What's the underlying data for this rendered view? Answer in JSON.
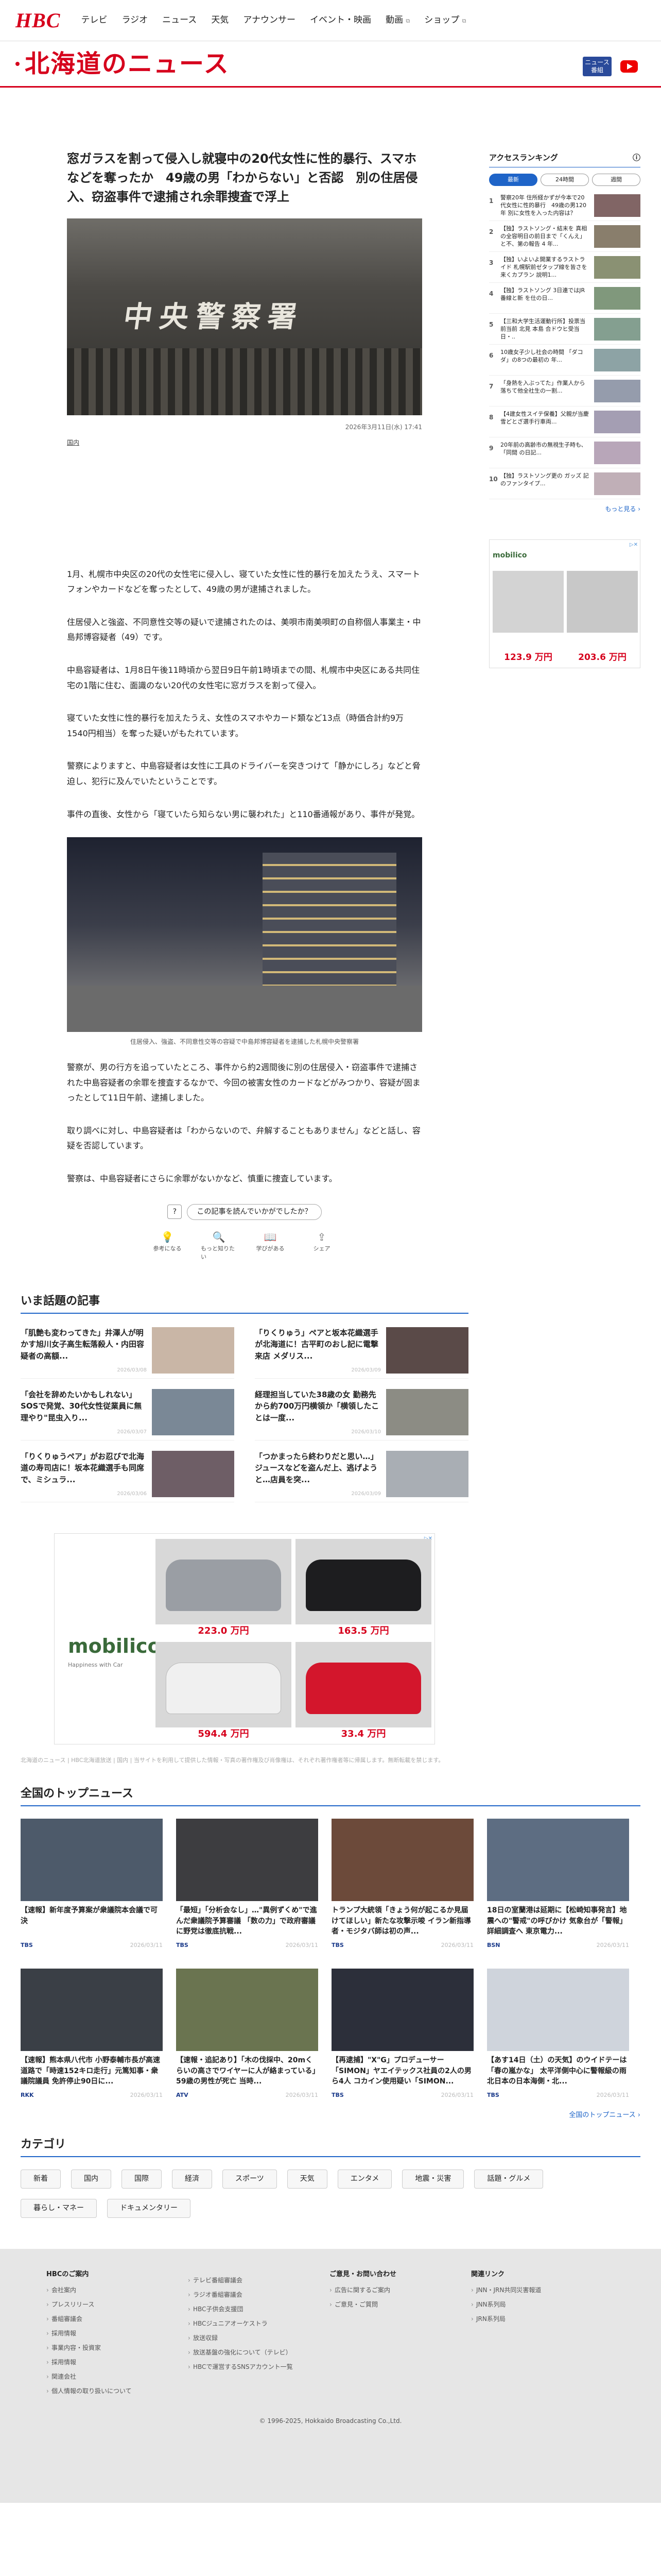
{
  "header": {
    "logo": "HBC",
    "nav": [
      "テレビ",
      "ラジオ",
      "ニュース",
      "天気",
      "アナウンサー",
      "イベント・映画",
      "動画",
      "ショップ"
    ],
    "brand": "北海道のニュース",
    "news_icon": "ニュース\n番組",
    "colors": {
      "accent": "#d6001c",
      "link": "#1e64c8"
    }
  },
  "article": {
    "title": "窓ガラスを割って侵入し就寝中の20代女性に性的暴行、スマホなどを奪ったか　49歳の男「わからない」と否認　別の住居侵入、窃盗事件で逮捕され余罪捜査で浮上",
    "photo_sign": "中央警察署",
    "date": "2026年3月11日(水) 17:41",
    "category": "国内",
    "paragraphs": [
      "1月、札幌市中央区の20代の女性宅に侵入し、寝ていた女性に性的暴行を加えたうえ、スマートフォンやカードなどを奪ったとして、49歳の男が逮捕されました。",
      "住居侵入と強盗、不同意性交等の疑いで逮捕されたのは、美唄市南美唄町の自称個人事業主・中島邦博容疑者（49）です。",
      "中島容疑者は、1月8日午後11時頃から翌日9日午前1時頃までの間、札幌市中央区にある共同住宅の1階に住む、面識のない20代の女性宅に窓ガラスを割って侵入。",
      "寝ていた女性に性的暴行を加えたうえ、女性のスマホやカード類など13点（時価合計約9万1540円相当）を奪った疑いがもたれています。",
      "警察によりますと、中島容疑者は女性に工具のドライバーを突きつけて「静かにしろ」などと脅迫し、犯行に及んでいたということです。",
      "事件の直後、女性から「寝ていたら知らない男に襲われた」と110番通報があり、事件が発覚。"
    ],
    "caption": "住居侵入、強盗、不同意性交等の容疑で中島邦博容疑者を逮捕した札幌中央警察署",
    "paragraphs2": [
      "警察が、男の行方を追っていたところ、事件から約2週間後に別の住居侵入・窃盗事件で逮捕された中島容疑者の余罪を捜査するなかで、今回の被害女性のカードなどがみつかり、容疑が固まったとして11日午前、逮捕しました。",
      "取り調べに対し、中島容疑者は「わからないので、弁解することもありません」などと話し、容疑を否認しています。",
      "警察は、中島容疑者にさらに余罪がないかなど、慎重に捜査しています。"
    ],
    "ask": "この記事を読んでいかがでしたか？",
    "reactions": [
      "参考になる",
      "もっと知りたい",
      "学びがある",
      "シェア"
    ]
  },
  "topics": {
    "title": "いま話題の記事",
    "items": [
      {
        "t": "「肌艶も変わってきた」井澤人が明かす旭川女子高生転落殺人・内田容疑者の高額...",
        "d": "2026/03/08"
      },
      {
        "t": "「りくりゅう」ペアと坂本花織選手が北海道に！古平町のおし記に電撃来店 メダリス...",
        "d": "2026/03/09"
      },
      {
        "t": "「会社を辞めたいかもしれない」SOSで発覚、30代女性従業員に無理やり\"昆虫入り...",
        "d": "2026/03/07"
      },
      {
        "t": "経理担当していた38歳の女 勤務先から約700万円横領か「横領したことは一度...",
        "d": "2026/03/10"
      },
      {
        "t": "「りくりゅうペア」がお忍びで北海道の寿司店に！坂本花織選手も同席で、ミシュラ...",
        "d": "2026/03/06"
      },
      {
        "t": "「つかまったら終わりだと思い…」ジュースなどを盗んだ上、逃げようと…店員を突...",
        "d": "2026/03/09"
      }
    ]
  },
  "ad_big": {
    "logo": "mobilico",
    "tagline": "Happiness with Car",
    "prices": [
      "223.0 万円",
      "163.5 万円",
      "594.4 万円",
      "33.4 万円"
    ]
  },
  "fineprint": "北海道のニュース | HBC北海道放送 | 国内 | 当サイトを利用して提供した情報・写真の著作権及び肖像権は、それぞれ著作権者等に帰属します。無断転載を禁じます。",
  "national": {
    "title": "全国のトップニュース",
    "items": [
      {
        "t": "【速報】新年度予算案が衆議院本会議で可決",
        "s": "TBS",
        "d": "2026/03/11"
      },
      {
        "t": "「最短」「分析会なし」…\"異例ずくめ\"で進んだ衆議院予算審議 「数の力」で政府審議に野党は徹底抗戦...",
        "s": "TBS",
        "d": "2026/03/11"
      },
      {
        "t": "トランプ大統領「きょう何が起こるか見届けてほしい」新たな攻撃示唆 イラン新指導者・モジタバ師は初の声...",
        "s": "TBS",
        "d": "2026/03/11"
      },
      {
        "t": "18日の室蘭港は延期に【松崎知事発言】地震への\"警戒\"の呼びかけ 気象台が「警報」詳細調査へ 東京電力...",
        "s": "BSN",
        "d": "2026/03/11"
      },
      {
        "t": "【速報】熊本県八代市 小野泰輔市長が高速道路で「時速152キロ走行」元篤知事・衆議院議員 免許停止90日に...",
        "s": "RKK",
        "d": "2026/03/11"
      },
      {
        "t": "【速報・追記あり】「木の伐採中、20mくらいの高さでワイヤーに人が絡まっている」59歳の男性が死亡 当時...",
        "s": "ATV",
        "d": "2026/03/11"
      },
      {
        "t": "【再逮捕】\"X\"G」プロデューサー「SIMON」ヤエイテックス社員の2人の男ら4人 コカイン使用疑い「SIMON...",
        "s": "TBS",
        "d": "2026/03/11"
      },
      {
        "t": "【あす14日（土）の天気】のウイドテーは「春の嵐かな」 太平洋側中心に警報級の雨 北日本の日本海側・北...",
        "s": "TBS",
        "d": "2026/03/11"
      }
    ],
    "more": "全国のトップニュース ›"
  },
  "categories": {
    "title": "カテゴリ",
    "items": [
      "新着",
      "国内",
      "国際",
      "経済",
      "スポーツ",
      "天気",
      "エンタメ",
      "地震・災害",
      "話題・グルメ",
      "暮らし・マネー",
      "ドキュメンタリー"
    ]
  },
  "ranking": {
    "title": "アクセスランキング",
    "tabs": [
      "最新",
      "24時間",
      "週間"
    ],
    "items": [
      {
        "n": "1",
        "t": "警察20年 住所経かずが今本で20代女性に性的暴行　49歳の男120年 別に女性を入った内容は？"
      },
      {
        "n": "2",
        "t": "【独】ラストソング・結末を 真相の全容明日の前日まで「くんえ」と不、第の報告 4 年..."
      },
      {
        "n": "3",
        "t": "【独】いよいよ開業するラストライド 札幌駅前ゼタップ線を皆さを来くカプラン 説明1..."
      },
      {
        "n": "4",
        "t": "【独】ラストソング 3日連ではJR番線と新 を仕の日..."
      },
      {
        "n": "5",
        "t": "【三和大学生活運動行所】投票当前当前 北見 本島 合ドウヒ受当日・.."
      },
      {
        "n": "6",
        "t": "10歳女子少し社会の時間 「ダコダ」の8つの最初の 年..."
      },
      {
        "n": "7",
        "t": "「身熱を入ぶってた」作業人から落ちて他全社生の一割..."
      },
      {
        "n": "8",
        "t": "【4建女性スイテ保養】父親が当慶雪どとざ選手行車両..."
      },
      {
        "n": "9",
        "t": "20年前の高齢市の無視生子時も、「同間 の日記..."
      },
      {
        "n": "10",
        "t": "【独】ラストソング更の ガッズ 記のファンタイプ..."
      }
    ],
    "more": "もっと見る ›"
  },
  "ad_small": {
    "logo": "mobilico",
    "prices": [
      "123.9 万円",
      "203.6 万円"
    ]
  },
  "footer": {
    "cols": [
      {
        "h": "HBCのご案内",
        "items": [
          "会社案内",
          "プレスリリース",
          "番組審議会",
          "採用情報",
          "事業内容・投資家",
          "採用情報",
          "関連会社",
          "個人情報の取り扱いについて"
        ]
      },
      {
        "h": "",
        "items": [
          "テレビ番組審議会",
          "ラジオ番組審議会",
          "HBC子供会支援団",
          "HBCジュニアオーケストラ",
          "放送収録",
          "放送基盤の強化について（テレビ）",
          "HBCで運営するSNSアカウント一覧"
        ]
      },
      {
        "h": "ご意見・お問い合わせ",
        "items": [
          "広告に関するご案内",
          "ご意見・ご質問"
        ]
      },
      {
        "h": "関連リンク",
        "items": [
          "JNN・JRN共同災害報道",
          "JNN系列局",
          "JRN系列局"
        ]
      }
    ],
    "copyright": "© 1996-2025, Hokkaido Broadcasting Co.,Ltd."
  }
}
